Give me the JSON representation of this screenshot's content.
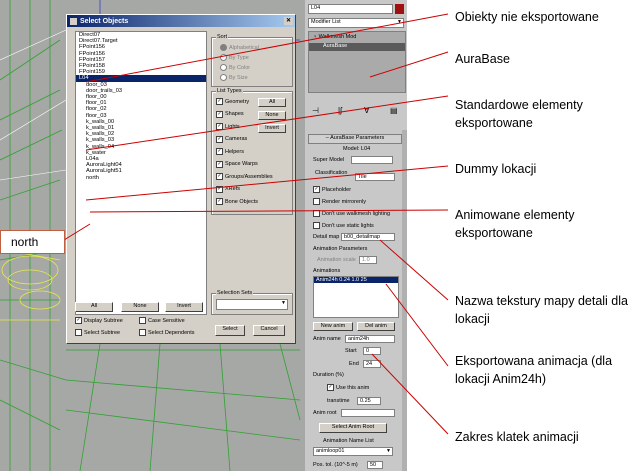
{
  "dialog": {
    "title": "Select Objects",
    "list_items": [
      {
        "label": "Direct07",
        "indent": false,
        "selected": false
      },
      {
        "label": "Direct07.Target",
        "indent": false,
        "selected": false
      },
      {
        "label": "FPoint156",
        "indent": false,
        "selected": false
      },
      {
        "label": "FPoint156",
        "indent": false,
        "selected": false
      },
      {
        "label": "FPoint157",
        "indent": false,
        "selected": false
      },
      {
        "label": "FPoint158",
        "indent": false,
        "selected": false
      },
      {
        "label": "FPoint159",
        "indent": false,
        "selected": false
      },
      {
        "label": "L04",
        "indent": false,
        "selected": true
      },
      {
        "label": "door_03",
        "indent": true,
        "selected": false
      },
      {
        "label": "door_trails_03",
        "indent": true,
        "selected": false
      },
      {
        "label": "floor_00",
        "indent": true,
        "selected": false
      },
      {
        "label": "floor_01",
        "indent": true,
        "selected": false
      },
      {
        "label": "floor_02",
        "indent": true,
        "selected": false
      },
      {
        "label": "floor_03",
        "indent": true,
        "selected": false
      },
      {
        "label": "k_walls_00",
        "indent": true,
        "selected": false
      },
      {
        "label": "k_walls_01",
        "indent": true,
        "selected": false
      },
      {
        "label": "k_walls_02",
        "indent": true,
        "selected": false
      },
      {
        "label": "k_walls_03",
        "indent": true,
        "selected": false
      },
      {
        "label": "k_walls_04",
        "indent": true,
        "selected": false
      },
      {
        "label": "k_water",
        "indent": true,
        "selected": false
      },
      {
        "label": "L04a",
        "indent": true,
        "selected": false
      },
      {
        "label": "AuroraLight04",
        "indent": true,
        "selected": false
      },
      {
        "label": "AuroraLight51",
        "indent": true,
        "selected": false
      },
      {
        "label": "north",
        "indent": true,
        "selected": false
      }
    ],
    "sort": {
      "label": "Sort",
      "options": [
        "Alphabetical",
        "By Type",
        "By Color",
        "By Size"
      ]
    },
    "list_types": {
      "label": "List Types",
      "items": [
        "Geometry",
        "Shapes",
        "Lights",
        "Cameras",
        "Helpers",
        "Space Warps",
        "Groups/Assemblies",
        "XRefs",
        "Bone Objects"
      ],
      "all": "All",
      "none": "None",
      "invert": "Invert"
    },
    "selection_sets": {
      "label": "Selection Sets"
    },
    "bottom": {
      "all": "All",
      "none": "None",
      "invert": "Invert",
      "display_subtree": "Display Subtree",
      "case_sensitive": "Case Sensitive",
      "select_subtree": "Select Subtree",
      "select_dependents": "Select Dependents",
      "select": "Select",
      "cancel": "Cancel"
    }
  },
  "cmd_panel": {
    "name_field": "L04",
    "modifier_list": "Modifier List",
    "stack": [
      "Walkmesh Mod",
      "AuraBase"
    ],
    "rollout_title": "AuraBase Parameters",
    "model_label": "Model: L04",
    "super_model": "Super Model",
    "classification": "Classification",
    "classification_value": "Tile",
    "placeholder": "Placeholder",
    "render_mirror": "Render mirrorenly",
    "dont_use_walkmesh": "Don't use walkmesh lighting",
    "dont_use_static": "Don't use static lights",
    "detail_map_label": "Detail map",
    "detail_map_value": "b00_detailmap",
    "anim_params": "Animation Parameters",
    "anim_scale": "Animation scale",
    "anim_scale_value": "1.0",
    "animations_label": "Animations",
    "anim_entry": "Anim24h 0.24 1.0 25",
    "new_anim": "New anim",
    "del_anim": "Del anim",
    "anim_name_label": "Anim name",
    "anim_name_value": "anim24h",
    "start_label": "Start",
    "start_value": "0",
    "end_label": "End",
    "end_value": "24",
    "duration_label": "Duration (%)",
    "use_this_anim": "Use this anim",
    "transtime_label": "transtime",
    "transtime_value": "0.25",
    "anim_root_label": "Anim root",
    "select_anim_root": "Select Anim Root",
    "anim_name_list": "Animation Name List",
    "anim_list_value": "animloop01",
    "pos_tol_label": "Pos. tol. (10^-5 m)",
    "pos_tol_value": "50"
  },
  "annotations": {
    "a1": "Obiekty nie eksportowane",
    "a2": "AuraBase",
    "a3": "Standardowe elementy eksportowane",
    "a4": "Dummy lokacji",
    "a5": "Animowane elementy eksportowane",
    "a6": "Nazwa tekstury mapy detali dla lokacji",
    "a7": "Eksportowana animacja (dla lokacji Anim24h)",
    "a8": "Zakres klatek animacji",
    "north": "north"
  },
  "colors": {
    "highlight": "#0a246a",
    "callout_line": "#cc0000",
    "dialog_bg": "#d4d0c8"
  }
}
